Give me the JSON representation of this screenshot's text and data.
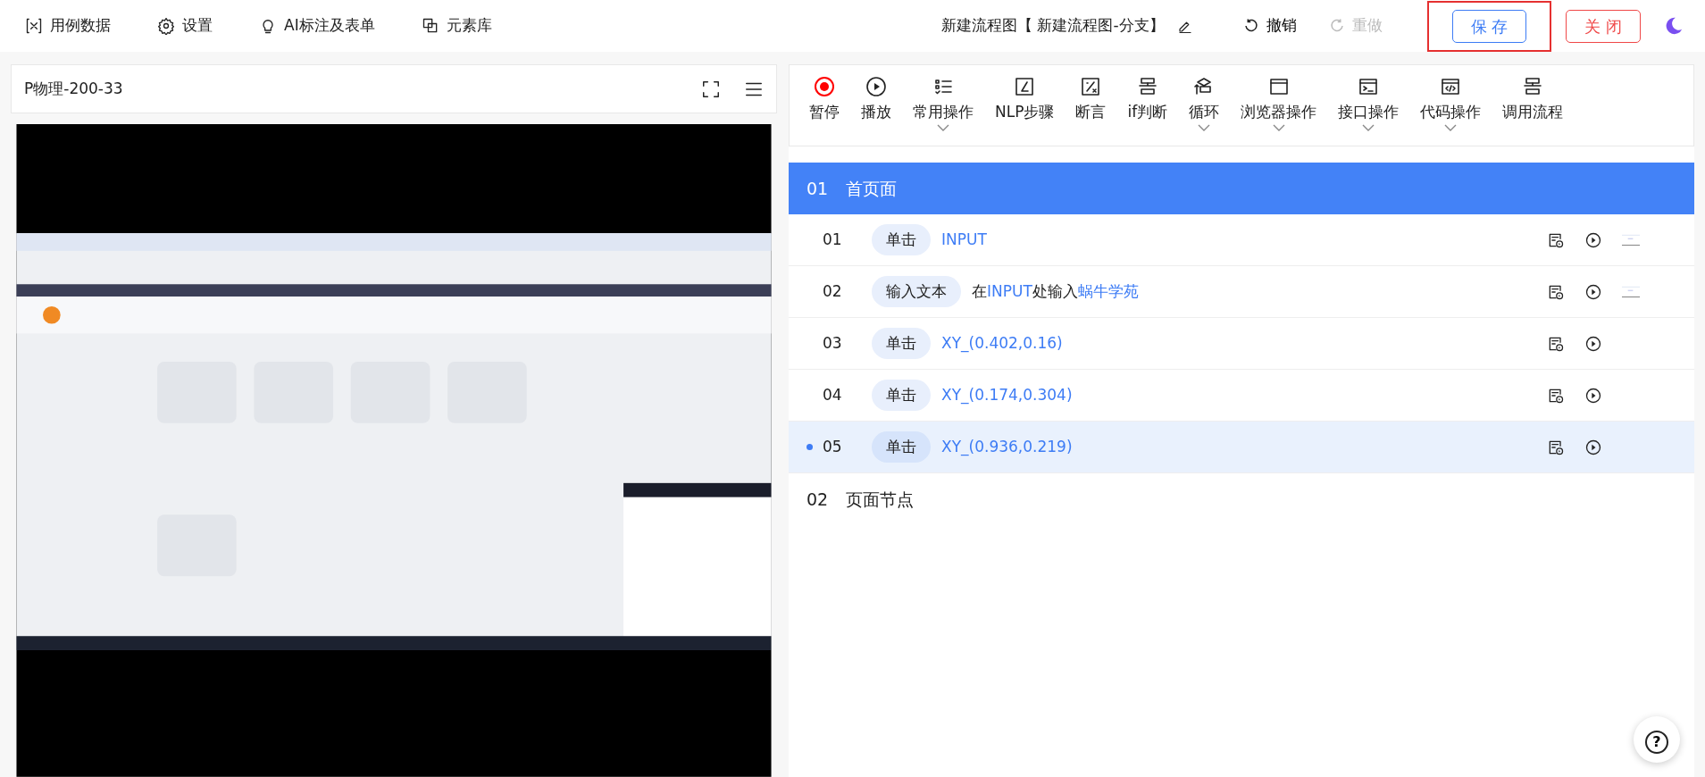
{
  "top_bar": {
    "menu": [
      {
        "label": "用例数据"
      },
      {
        "label": "设置"
      },
      {
        "label": "AI标注及表单"
      },
      {
        "label": "元素库"
      }
    ],
    "title": "新建流程图【 新建流程图-分支】",
    "actions": [
      {
        "kind": "undo",
        "label": "撤销",
        "disabled": false
      },
      {
        "kind": "redo",
        "label": "重做",
        "disabled": true
      }
    ],
    "buttons": [
      {
        "kind": "primary",
        "label": "保 存",
        "highlighted": true
      },
      {
        "kind": "danger",
        "label": "关 闭"
      }
    ]
  },
  "preview": {
    "title": "P物理-200-33"
  },
  "toolbar": [
    {
      "label": "暂停",
      "dropdown": false
    },
    {
      "label": "播放",
      "dropdown": false
    },
    {
      "label": "常用操作",
      "dropdown": true
    },
    {
      "label": "NLP步骤",
      "dropdown": false
    },
    {
      "label": "断言",
      "dropdown": false
    },
    {
      "label": "if判断",
      "dropdown": false
    },
    {
      "label": "循环",
      "dropdown": true
    },
    {
      "label": "浏览器操作",
      "dropdown": true
    },
    {
      "label": "接口操作",
      "dropdown": true
    },
    {
      "label": "代码操作",
      "dropdown": true
    },
    {
      "label": "调用流程",
      "dropdown": false
    }
  ],
  "steps": {
    "pages": [
      {
        "index": "01",
        "title": "首页面",
        "selected": true,
        "steps": [
          {
            "index": "01",
            "action": "单击",
            "segments": [
              {
                "text": "INPUT",
                "highlight": true
              }
            ],
            "preview": true,
            "selected": false
          },
          {
            "index": "02",
            "action": "输入文本",
            "segments": [
              {
                "text": "在",
                "highlight": false
              },
              {
                "text": "INPUT",
                "highlight": true
              },
              {
                "text": "处输入",
                "highlight": false
              },
              {
                "text": "蜗牛学苑",
                "highlight": true
              }
            ],
            "preview": true,
            "selected": false
          },
          {
            "index": "03",
            "action": "单击",
            "segments": [
              {
                "text": "XY_(0.402,0.16)",
                "highlight": true
              }
            ],
            "preview": false,
            "selected": false
          },
          {
            "index": "04",
            "action": "单击",
            "segments": [
              {
                "text": "XY_(0.174,0.304)",
                "highlight": true
              }
            ],
            "preview": false,
            "selected": false
          },
          {
            "index": "05",
            "action": "单击",
            "segments": [
              {
                "text": "XY_(0.936,0.219)",
                "highlight": true
              }
            ],
            "preview": false,
            "selected": true
          }
        ]
      },
      {
        "index": "02",
        "title": "页面节点",
        "selected": false
      }
    ]
  },
  "help_button": {
    "label": "?"
  }
}
